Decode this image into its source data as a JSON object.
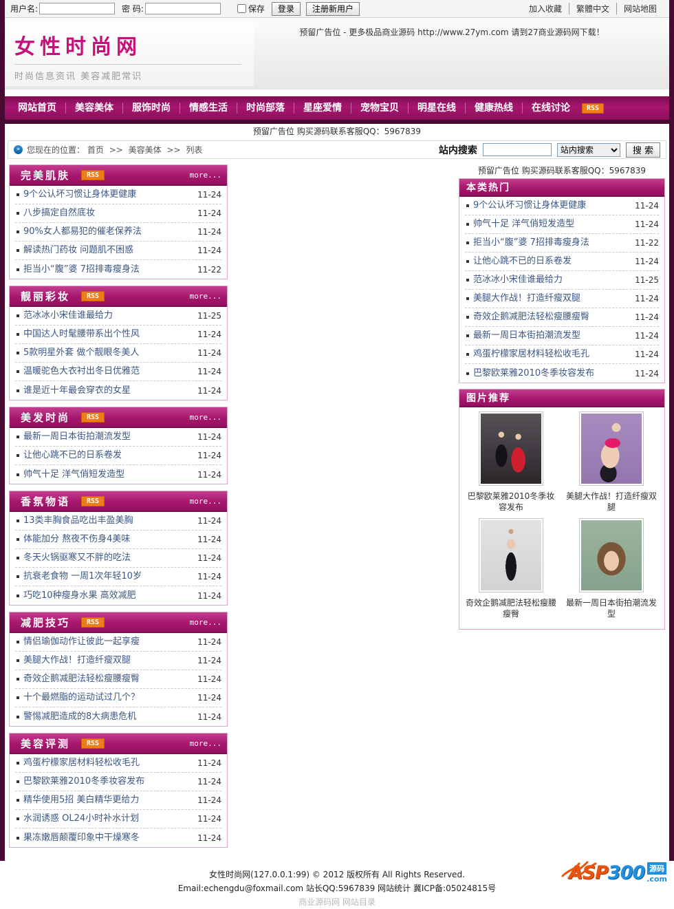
{
  "topbar": {
    "username_label": "用户名:",
    "password_label": "密 码:",
    "save_label": "保存",
    "login_button": "登录",
    "register_button": "注册新用户",
    "links": [
      "加入收藏",
      "繁體中文",
      "网站地图"
    ]
  },
  "header": {
    "logo": "女性时尚网",
    "slogan": "时尚信息资讯 美容减肥常识",
    "ad": "预留广告位 - 更多极品商业源码 http://www.27ym.com 请到27商业源码网下载！"
  },
  "nav": {
    "items": [
      "网站首页",
      "美容美体",
      "服饰时尚",
      "情感生活",
      "时尚部落",
      "星座爱情",
      "宠物宝贝",
      "明星在线",
      "健康热线",
      "在线讨论"
    ],
    "rss_label": "RSS"
  },
  "ad_banner": "预留广告位 购买源码联系客服QQ：5967839",
  "breadcrumb": {
    "label": "您现在的位置：",
    "separator": ">>",
    "path": [
      "首页",
      "美容美体",
      "列表"
    ]
  },
  "search": {
    "label": "站内搜索",
    "input_value": "",
    "select_value": "站内搜索",
    "button_label": "搜 索"
  },
  "boxes": [
    {
      "title": "完美肌肤",
      "rss_label": "RSS",
      "more_label": "more...",
      "items": [
        {
          "title": "9个公认坏习惯让身体更健康",
          "date": "11-24"
        },
        {
          "title": "八步搞定自然底妆",
          "date": "11-24"
        },
        {
          "title": "90%女人都易犯的催老保养法",
          "date": "11-24"
        },
        {
          "title": "解读热门药妆 问题肌不困惑",
          "date": "11-24"
        },
        {
          "title": "拒当小“腹”婆 7招排毒瘦身法",
          "date": "11-22"
        }
      ]
    },
    {
      "title": "靓丽彩妆",
      "rss_label": "RSS",
      "more_label": "more...",
      "items": [
        {
          "title": "范冰冰小宋佳谁最给力",
          "date": "11-25"
        },
        {
          "title": "中国达人时髦腰带系出个性风",
          "date": "11-24"
        },
        {
          "title": "5款明星外套 做个靓眼冬美人",
          "date": "11-24"
        },
        {
          "title": "温暖驼色大衣衬出冬日优雅范",
          "date": "11-24"
        },
        {
          "title": "谁是近十年最会穿衣的女星",
          "date": "11-24"
        }
      ]
    },
    {
      "title": "美发时尚",
      "rss_label": "RSS",
      "more_label": "more...",
      "items": [
        {
          "title": "最新一周日本街拍潮流发型",
          "date": "11-24"
        },
        {
          "title": "让他心跳不已的日系卷发",
          "date": "11-24"
        },
        {
          "title": "帅气十足 洋气俏短发造型",
          "date": "11-24"
        }
      ]
    },
    {
      "title": "香氛物语",
      "rss_label": "RSS",
      "more_label": "more...",
      "items": [
        {
          "title": "13类丰胸食品吃出丰盈美胸",
          "date": "11-24"
        },
        {
          "title": "体能加分 熬夜不伤身4美味",
          "date": "11-24"
        },
        {
          "title": "冬天火锅驱寒又不胖的吃法",
          "date": "11-24"
        },
        {
          "title": "抗衰老食物 一周1次年轻10岁",
          "date": "11-24"
        },
        {
          "title": "巧吃10种瘦身水果 高效减肥",
          "date": "11-24"
        }
      ]
    },
    {
      "title": "减肥技巧",
      "rss_label": "RSS",
      "more_label": "more...",
      "items": [
        {
          "title": "情侣瑜伽动作让彼此一起享瘦",
          "date": "11-24"
        },
        {
          "title": "美腿大作战！打造纤瘦双腿",
          "date": "11-24"
        },
        {
          "title": "奇效企鹅减肥法轻松瘦腰瘦臀",
          "date": "11-24"
        },
        {
          "title": "十个最燃脂的运动试过几个？",
          "date": "11-24"
        },
        {
          "title": "警惕减肥造成的8大病患危机",
          "date": "11-24"
        }
      ]
    },
    {
      "title": "美容评测",
      "rss_label": "RSS",
      "more_label": "more...",
      "items": [
        {
          "title": "鸡蛋柠檬家居材料轻松收毛孔",
          "date": "11-24"
        },
        {
          "title": "巴黎欧莱雅2010冬季妆容发布",
          "date": "11-24"
        },
        {
          "title": "精华使用5招 美白精华更给力",
          "date": "11-24"
        },
        {
          "title": "水润诱惑 OL24小时补水计划",
          "date": "11-24"
        },
        {
          "title": "果冻嫩唇颠覆印象中干燥寒冬",
          "date": "11-24"
        }
      ]
    }
  ],
  "sidebar": {
    "ad": "预留广告位 购买源码联系客服QQ：5967839",
    "hot": {
      "title": "本类热门",
      "items": [
        {
          "title": "9个公认坏习惯让身体更健康",
          "date": "11-24"
        },
        {
          "title": "帅气十足 洋气俏短发造型",
          "date": "11-24"
        },
        {
          "title": "拒当小“腹”婆 7招排毒瘦身法",
          "date": "11-22"
        },
        {
          "title": "让他心跳不已的日系卷发",
          "date": "11-24"
        },
        {
          "title": "范冰冰小宋佳谁最给力",
          "date": "11-25"
        },
        {
          "title": "美腿大作战！打造纤瘦双腿",
          "date": "11-24"
        },
        {
          "title": "奇效企鹅减肥法轻松瘦腰瘦臀",
          "date": "11-24"
        },
        {
          "title": "最新一周日本街拍潮流发型",
          "date": "11-24"
        },
        {
          "title": "鸡蛋柠檬家居材料轻松收毛孔",
          "date": "11-24"
        },
        {
          "title": "巴黎欧莱雅2010冬季妆容发布",
          "date": "11-24"
        }
      ]
    },
    "pics": {
      "title": "图片推荐",
      "items": [
        {
          "caption": "巴黎欧莱雅2010冬季妆容发布"
        },
        {
          "caption": "美腿大作战！打造纤瘦双腿"
        },
        {
          "caption": "奇效企鹅减肥法轻松瘦腰瘦臀"
        },
        {
          "caption": "最新一周日本街拍潮流发型"
        }
      ]
    }
  },
  "footer": {
    "line1": "女性时尚网(127.0.0.1:99) © 2012 版权所有 All Rights Reserved.",
    "line2": "Email:echengdu@foxmail.com 站长QQ:5967839 网站统计  冀ICP备:05024815号",
    "line3": "商业源码网 网站目录",
    "logo": {
      "asp": "ASP",
      "num": "300",
      "yuanma": "源码",
      "com": ".com"
    }
  }
}
